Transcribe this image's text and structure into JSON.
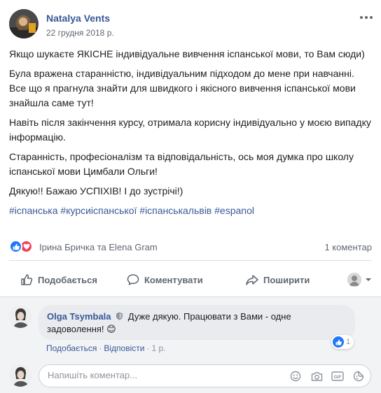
{
  "post": {
    "author": "Natalya Vents",
    "date": "22 грудня 2018 р.",
    "paragraphs": [
      "Якщо шукаєте ЯКІСНЕ індивідуальне вивчення іспанської мови, то Вам сюди)",
      "Була вражена старанністю, індивідуальним підходом до мене при навчанні. Все що я прагнула знайти для швидкого і якісного вивчення іспанської мови знайшла саме тут!",
      "Навіть після закінчення курсу, отримала корисну індивідуально у моєю випадку інформацію.",
      "Старанність, професіоналізм та відповідальність, ось моя думка про школу іспанської мови Цимбали Ольги!",
      "Дякую!! Бажаю УСПІХІВ! І до зустрічі!)"
    ],
    "hashtags": [
      "#іспанська",
      "#курсиіспанської",
      "#іспанськальвів",
      "#espanol"
    ]
  },
  "reactions": {
    "names": "Ірина Бричка та Elena Gram",
    "comment_count": "1 коментар"
  },
  "actions": {
    "like_label": "Подобається",
    "comment_label": "Коментувати",
    "share_label": "Поширити"
  },
  "comment": {
    "author": "Olga Tsymbala",
    "text": "Дуже дякую. Працювати з Вами - одне задоволення!",
    "emoji": "😊",
    "like_label": "Подобається",
    "reply_label": "Відповісти",
    "age": "1 р.",
    "reaction_count": "1"
  },
  "composer": {
    "placeholder": "Напишіть коментар..."
  },
  "colors": {
    "link": "#385898",
    "like_blue": "#2078f4",
    "love_red": "#f33e58",
    "muted": "#616770"
  }
}
